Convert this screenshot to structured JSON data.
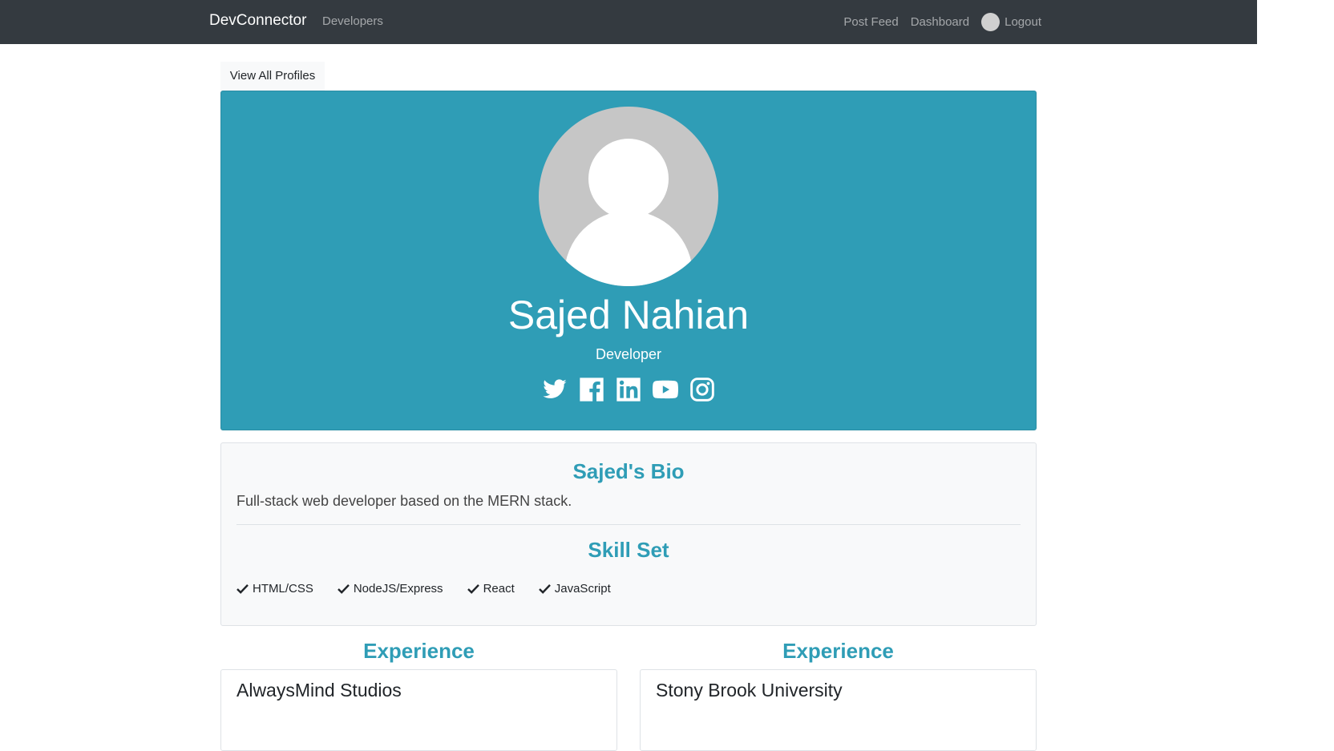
{
  "navbar": {
    "brand": "DevConnector",
    "developers": "Developers",
    "post_feed": "Post Feed",
    "dashboard": "Dashboard",
    "logout": "Logout"
  },
  "back_link": "View All Profiles",
  "profile": {
    "name": "Sajed Nahian",
    "role": "Developer",
    "socials": [
      "twitter-icon",
      "facebook-icon",
      "linkedin-icon",
      "youtube-icon",
      "instagram-icon"
    ],
    "accent_color": "#2f9db6"
  },
  "bio": {
    "title": "Sajed's Bio",
    "text": "Full-stack web developer based on the MERN stack."
  },
  "skills": {
    "title": "Skill Set",
    "items": [
      "HTML/CSS",
      "NodeJS/Express",
      "React",
      "JavaScript"
    ]
  },
  "columns": [
    {
      "title": "Experience",
      "entry": "AlwaysMind Studios"
    },
    {
      "title": "Experience",
      "entry": "Stony Brook University"
    }
  ]
}
